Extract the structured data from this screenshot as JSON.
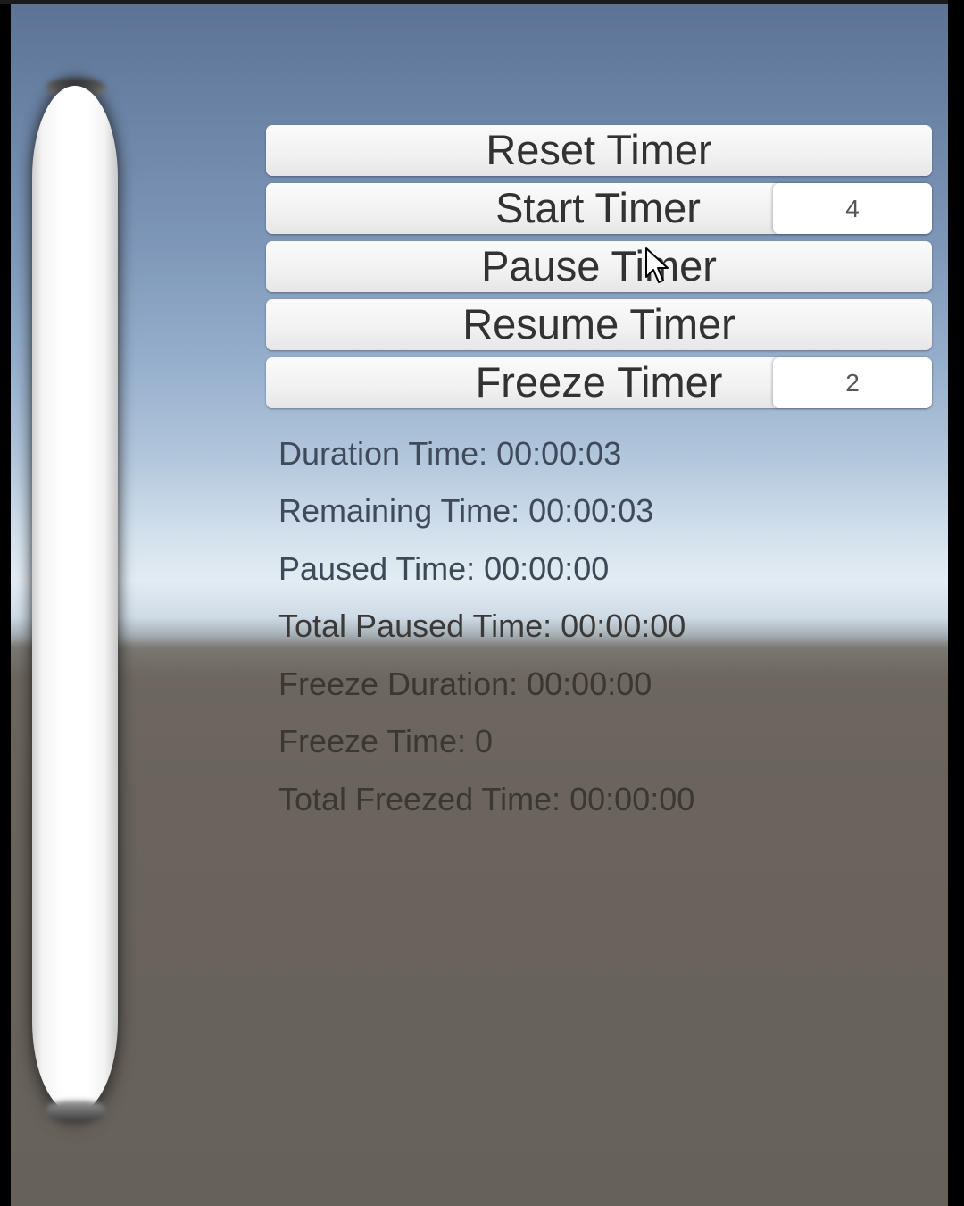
{
  "buttons": {
    "reset": "Reset Timer",
    "start": "Start Timer",
    "pause": "Pause Timer",
    "resume": "Resume Timer",
    "freeze": "Freeze Timer"
  },
  "inputs": {
    "start_value": "4",
    "freeze_value": "2"
  },
  "info": {
    "duration": "Duration Time: 00:00:03",
    "remaining": "Remaining Time: 00:00:03",
    "paused": "Paused Time: 00:00:00",
    "total_paused": "Total Paused Time: 00:00:00",
    "freeze_duration": "Freeze Duration: 00:00:00",
    "freeze_time": "Freeze Time: 0",
    "total_freezed": "Total Freezed Time: 00:00:00"
  },
  "colors": {
    "sky_top": "#5c7396",
    "horizon": "#e3ecf3",
    "ground": "#67615b",
    "button_face": "#f1f1f1",
    "text_light": "#3d4a5c",
    "text_dark": "#3e3a36"
  },
  "icons": {
    "cursor": "arrow-pointer-icon"
  }
}
